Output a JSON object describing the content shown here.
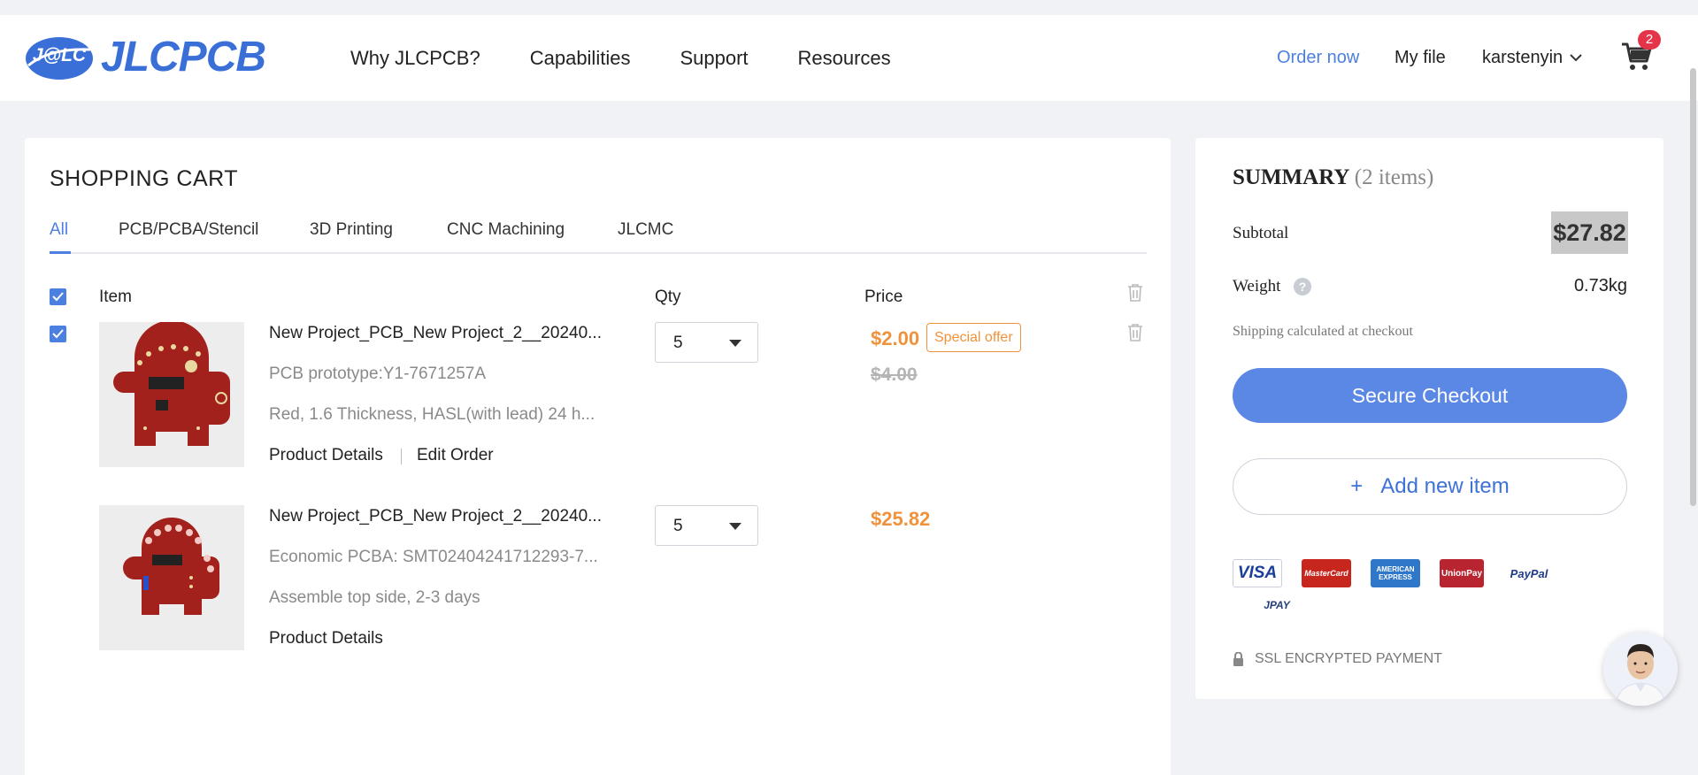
{
  "header": {
    "logo_badge": "J@LC",
    "logo_text": "JLCPCB",
    "nav": [
      "Why JLCPCB?",
      "Capabilities",
      "Support",
      "Resources"
    ],
    "order_now": "Order now",
    "my_file": "My file",
    "username": "karstenyin",
    "cart_count": "2"
  },
  "cart": {
    "title": "SHOPPING CART",
    "tabs": [
      "All",
      "PCB/PCBA/Stencil",
      "3D Printing",
      "CNC Machining",
      "JLCMC"
    ],
    "columns": {
      "item": "Item",
      "qty": "Qty",
      "price": "Price"
    },
    "items": [
      {
        "name": "New Project_PCB_New Project_2__20240...",
        "line2": "PCB prototype:Y1-7671257A",
        "line3": "Red, 1.6 Thickness, HASL(with lead) 24 h...",
        "details_link": "Product Details",
        "edit_link": "Edit Order",
        "qty": "5",
        "price": "$2.00",
        "badge": "Special offer",
        "old_price": "$4.00"
      },
      {
        "name": "New Project_PCB_New Project_2__20240...",
        "line2": "Economic PCBA: SMT02404241712293-7...",
        "line3": "Assemble top side, 2-3 days",
        "details_link": "Product Details",
        "qty": "5",
        "price": "$25.82"
      }
    ]
  },
  "summary": {
    "title": "SUMMARY",
    "count": "(2 items)",
    "subtotal_label": "Subtotal",
    "subtotal_value": "$27.82",
    "weight_label": "Weight",
    "weight_value": "0.73kg",
    "help_glyph": "?",
    "shipping_note": "Shipping calculated at checkout",
    "checkout_label": "Secure Checkout",
    "add_label": "Add new item",
    "add_plus": "+",
    "payment_methods": [
      "VISA",
      "MasterCard",
      "AMERICAN EXPRESS",
      "UnionPay",
      "PayPal",
      "JPAY"
    ],
    "ssl_label": "SSL ENCRYPTED PAYMENT"
  },
  "colors": {
    "accent": "#4b7fe0",
    "checkout": "#5b88e4",
    "price": "#f0923a",
    "badge": "#e5344a",
    "pcb": "#a3211c"
  }
}
